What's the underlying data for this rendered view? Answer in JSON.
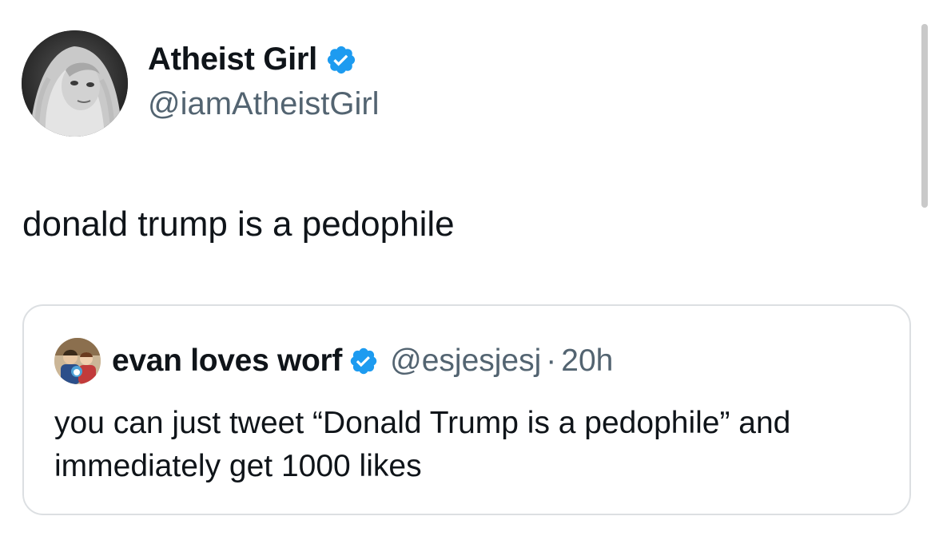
{
  "tweet": {
    "display_name": "Atheist Girl",
    "handle": "@iamAtheistGirl",
    "text": "donald trump is a pedophile",
    "verified_icon": "verified-badge-icon"
  },
  "quote": {
    "display_name": "evan loves worf",
    "handle": "@esjesjesj",
    "separator": "·",
    "time": "20h",
    "text": "you can just tweet “Donald Trump is a pedophile” and immediately get 1000 likes",
    "verified_icon": "verified-badge-icon"
  },
  "colors": {
    "verified_blue": "#1d9bf0",
    "secondary_text": "#536471",
    "primary_text": "#0f1419",
    "border": "#dcdfe2"
  }
}
